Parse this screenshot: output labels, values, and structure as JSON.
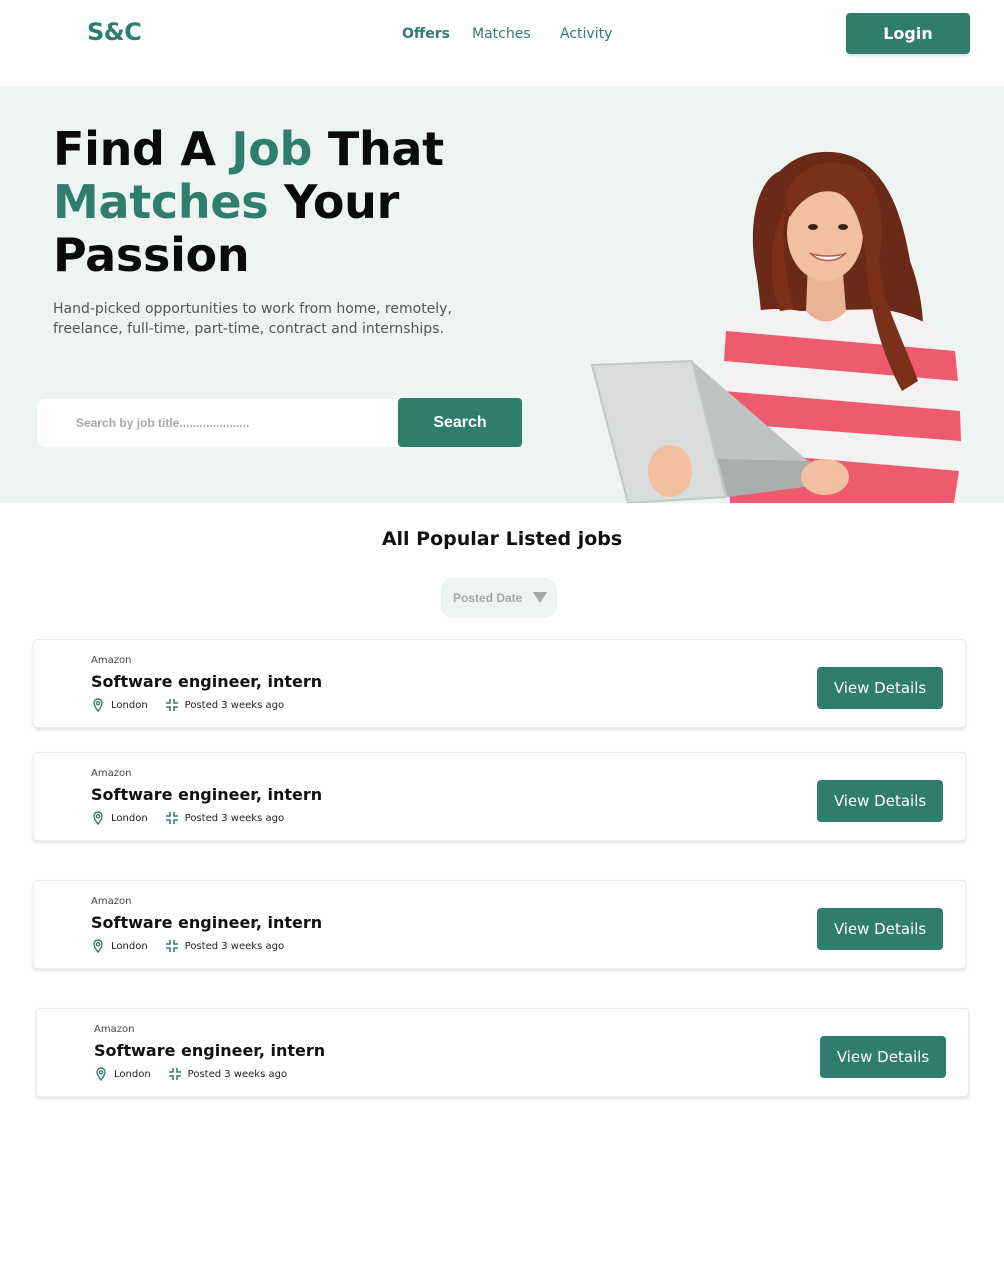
{
  "brand": {
    "logo": "S&C",
    "accent": "#2f7d6d",
    "hero_bg": "#eef4f1"
  },
  "nav": {
    "links": [
      "Offers",
      "Matches",
      "Activity"
    ],
    "active": "Offers",
    "login_label": "Login"
  },
  "hero": {
    "headline": {
      "part1": "Find A ",
      "accent1": "Job",
      "part2": " That",
      "accent2": "Matches",
      "part3": " Your",
      "part4": "Passion"
    },
    "subtext": "Hand-picked opportunities to work from home, remotely, freelance, full-time, part-time, contract and internships.",
    "search_placeholder": "Search by job title.....................",
    "search_label": "Search"
  },
  "listing": {
    "title": "All Popular Listed jobs",
    "sort_label": "Posted Date",
    "jobs": [
      {
        "company": "Amazon",
        "title": "Software engineer, intern",
        "location": "London",
        "posted": "Posted 3 weeks ago",
        "action": "View Details"
      },
      {
        "company": "Amazon",
        "title": "Software engineer, intern",
        "location": "London",
        "posted": "Posted 3 weeks ago",
        "action": "View Details"
      },
      {
        "company": "Amazon",
        "title": "Software engineer, intern",
        "location": "London",
        "posted": "Posted 3 weeks ago",
        "action": "View Details"
      },
      {
        "company": "Amazon",
        "title": "Software engineer, intern",
        "location": "London",
        "posted": "Posted 3 weeks ago",
        "action": "View Details"
      }
    ]
  },
  "icons": {
    "location": "map-pin-icon",
    "posted": "compress-arrows-icon",
    "sort": "triangle-down-icon"
  }
}
